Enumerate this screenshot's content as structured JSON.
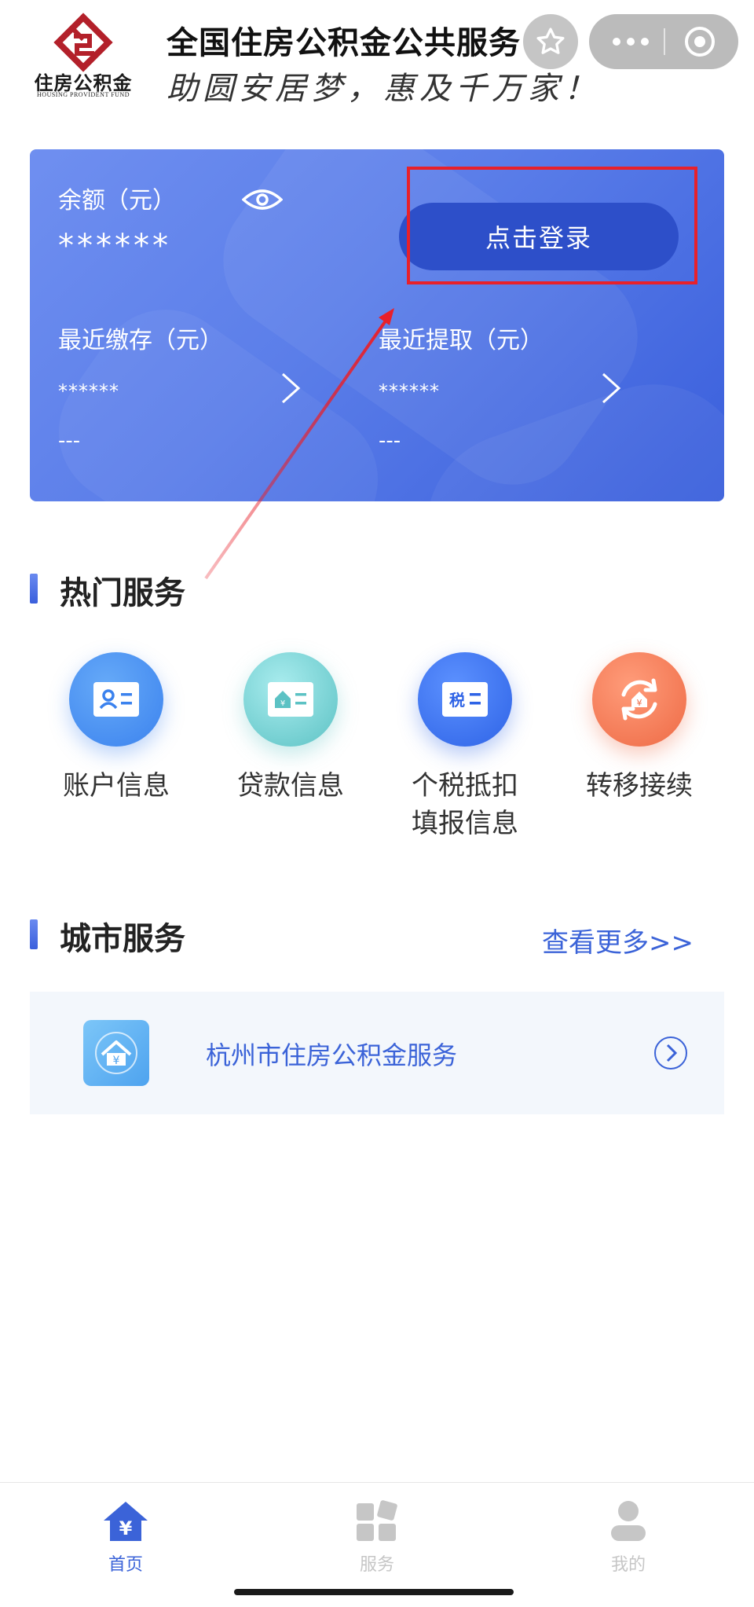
{
  "header": {
    "logo_cn": "住房公积金",
    "logo_en": "HOUSING  PROVIDENT  FUND",
    "title": "全国住房公积金公共服务",
    "slogan": "助圆安居梦，惠及千万家！"
  },
  "card": {
    "balance_label": "余额（元）",
    "balance_value": "******",
    "login_button": "点击登录",
    "recent_deposit_label": "最近缴存（元）",
    "recent_deposit_value": "******",
    "recent_deposit_date": "---",
    "recent_withdraw_label": "最近提取（元）",
    "recent_withdraw_value": "******",
    "recent_withdraw_date": "---"
  },
  "hot_services": {
    "title": "热门服务",
    "items": [
      {
        "label": "账户信息",
        "icon": "id-card-icon",
        "color": "#3b82ee"
      },
      {
        "label": "贷款信息",
        "icon": "loan-card-icon",
        "color": "#5cc2c4"
      },
      {
        "label": "个税抵扣填报信息",
        "line1": "个税抵扣",
        "line2": "填报信息",
        "icon": "tax-card-icon",
        "color": "#2e63e6",
        "badge": "税"
      },
      {
        "label": "转移接续",
        "icon": "transfer-icon",
        "color": "#ee6a45"
      }
    ]
  },
  "city_services": {
    "title": "城市服务",
    "more": "查看更多>>",
    "items": [
      {
        "label": "杭州市住房公积金服务",
        "icon": "house-yuan-icon"
      }
    ]
  },
  "bottom_nav": {
    "items": [
      {
        "label": "首页",
        "active": true
      },
      {
        "label": "服务",
        "active": false
      },
      {
        "label": "我的",
        "active": false
      }
    ]
  },
  "colors": {
    "accent": "#3b63d8",
    "card_start": "#6f8ff0",
    "card_end": "#3a5fdc",
    "highlight": "#e8202a"
  }
}
